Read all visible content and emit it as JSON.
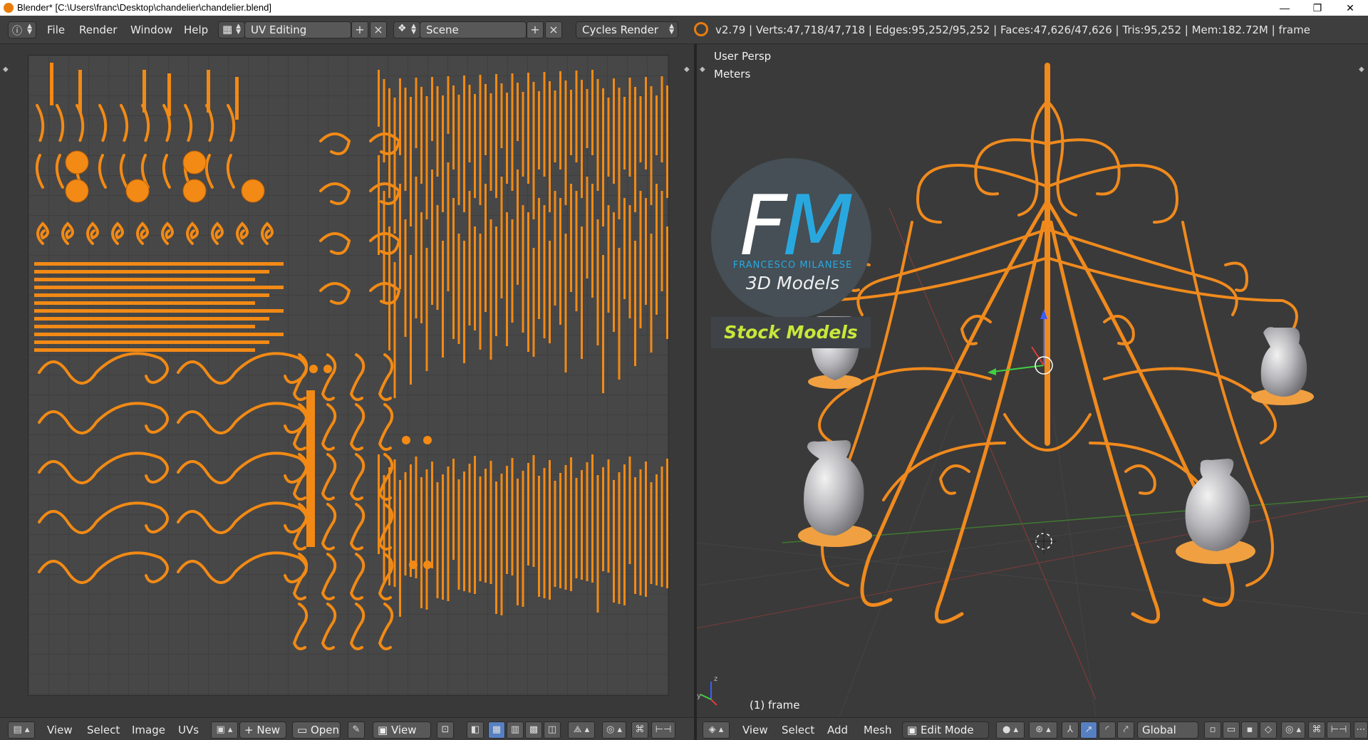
{
  "window": {
    "title": "Blender* [C:\\Users\\franc\\Desktop\\chandelier\\chandelier.blend]",
    "minimize_glyph": "—",
    "restore_glyph": "❐",
    "close_glyph": "✕"
  },
  "header": {
    "menus": [
      "File",
      "Render",
      "Window",
      "Help"
    ],
    "screen_layout": "UV Editing",
    "scene": "Scene",
    "render_engine": "Cycles Render",
    "stats": "v2.79 | Verts:47,718/47,718 | Edges:95,252/95,252 | Faces:47,626/47,626 | Tris:95,252 | Mem:182.72M | frame"
  },
  "uv_editor": {
    "menus": [
      "View",
      "Select",
      "Image",
      "UVs"
    ],
    "new_label": "New",
    "open_label": "Open",
    "view_label": "View"
  },
  "viewport": {
    "view_name": "User Persp",
    "units": "Meters",
    "object_label": "(1) frame",
    "menus": [
      "View",
      "Select",
      "Add",
      "Mesh"
    ],
    "mode": "Edit Mode",
    "orientation": "Global"
  },
  "watermark": {
    "letters_f": "F",
    "letters_m": "M",
    "name": "FRANCESCO MILANESE",
    "subtitle": "3D Models",
    "banner": "Stock Models"
  },
  "colors": {
    "uv_island": "#f28a15",
    "wire": "#f08a1d",
    "accent_blue": "#29a8e0",
    "banner_text": "#c7e83a"
  }
}
